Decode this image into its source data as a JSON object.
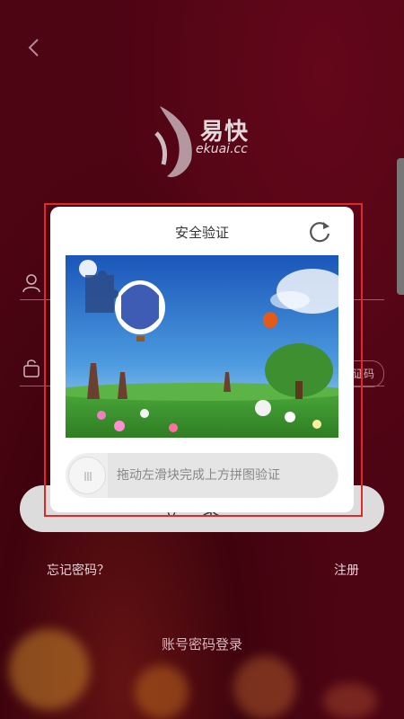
{
  "login": {
    "back_icon": "chevron-left-icon",
    "logo_text_cn": "易快",
    "logo_text_en": "ekuai.cc",
    "user_icon": "user-icon",
    "lock_icon": "lock-icon",
    "code_button_label": "证码",
    "login_button_label": "登录",
    "forgot_password": "忘记密码？",
    "register": "注册",
    "account_password_login": "账号密码登录"
  },
  "captcha": {
    "title": "安全验证",
    "refresh_icon": "refresh-icon",
    "slider_hint": "拖动左滑块完成上方拼图验证",
    "slider_icon": "grip-icon"
  },
  "colors": {
    "background": "#5d0617",
    "highlight_border": "#e02a2a"
  }
}
